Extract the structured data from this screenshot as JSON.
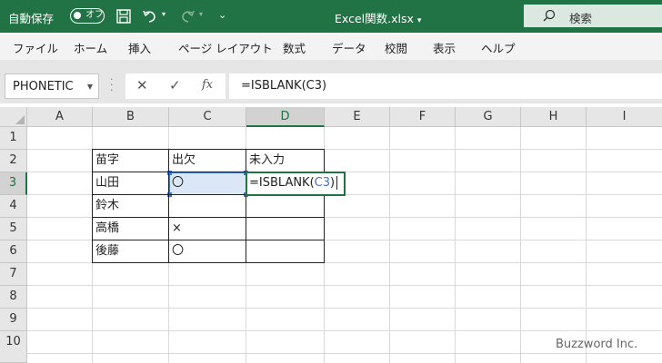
{
  "titlebar": {
    "autosave_label": "自動保存",
    "autosave_state": "オフ",
    "save_icon": "save-icon",
    "undo_icon": "undo-icon",
    "redo_icon": "redo-icon",
    "doc_title": "Excel関数.xlsx",
    "doc_title_caret": "▾",
    "search_placeholder": "検索",
    "accent": "#217346"
  },
  "menu": {
    "tabs": [
      "ファイル",
      "ホーム",
      "挿入",
      "ページ レイアウト",
      "数式",
      "データ",
      "校閲",
      "表示",
      "ヘルプ"
    ]
  },
  "formulabar": {
    "name_box": "PHONETIC",
    "cancel_glyph": "✕",
    "enter_glyph": "✓",
    "fx_glyph": "fx",
    "formula": "=ISBLANK(C3)"
  },
  "sheet": {
    "columns": [
      "A",
      "B",
      "C",
      "D",
      "E",
      "F",
      "G",
      "H",
      "I"
    ],
    "rows": [
      "1",
      "2",
      "3",
      "4",
      "5",
      "6",
      "7",
      "8",
      "9",
      "10"
    ],
    "active_column": "D",
    "active_row": "3",
    "header_row": [
      "苗字",
      "出欠",
      "未入力"
    ],
    "data_rows": [
      [
        "山田",
        "〇"
      ],
      [
        "鈴木",
        ""
      ],
      [
        "高橋",
        "×"
      ],
      [
        "後藤",
        "〇"
      ]
    ],
    "edit": {
      "prefix": "=ISBLANK(",
      "ref": "C3",
      "suffix": ")",
      "ref_color": "#4472c4"
    }
  },
  "watermark": "Buzzword Inc."
}
